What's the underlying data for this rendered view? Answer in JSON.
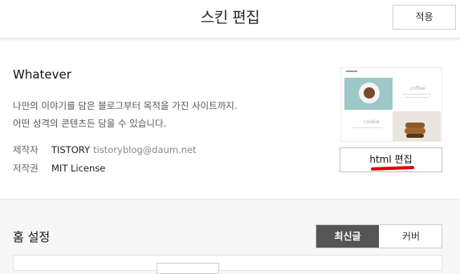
{
  "header": {
    "title": "스킨 편집",
    "apply_label": "적용"
  },
  "skin": {
    "name": "Whatever",
    "description_line1": "나만의 이야기를 담은 블로그부터 목적을 가진 사이트까지.",
    "description_line2": "어떤 성격의 콘텐츠든 담을 수 있습니다.",
    "maker_label": "제작자",
    "maker_value": "TISTORY",
    "maker_email": "tistoryblog@daum.net",
    "license_label": "저작권",
    "license_value": "MIT License",
    "html_edit_label": "html 편집"
  },
  "thumbnail": {
    "label_top": "coffee",
    "label_bottom": "cookie"
  },
  "home_settings": {
    "title": "홈 설정",
    "options": [
      "최신글",
      "커버"
    ],
    "selected": "최신글"
  },
  "colors": {
    "accent_underline": "#e00000",
    "active_option_bg": "#555555"
  }
}
